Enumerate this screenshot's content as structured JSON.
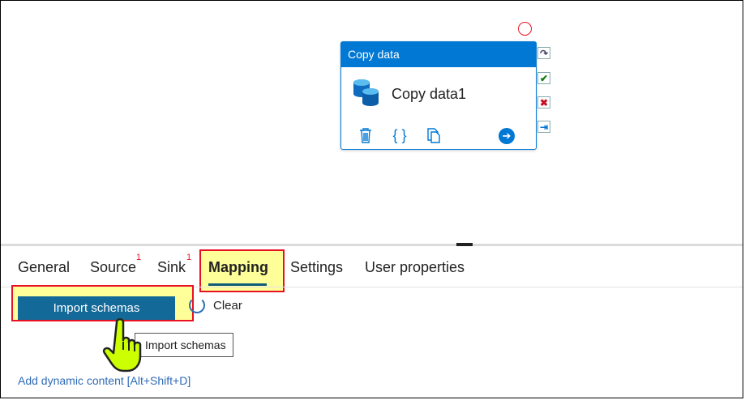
{
  "activity": {
    "header": "Copy data",
    "name": "Copy data1"
  },
  "tabs": [
    {
      "label": "General",
      "badge": ""
    },
    {
      "label": "Source",
      "badge": "1"
    },
    {
      "label": "Sink",
      "badge": "1"
    },
    {
      "label": "Mapping",
      "badge": ""
    },
    {
      "label": "Settings",
      "badge": ""
    },
    {
      "label": "User properties",
      "badge": ""
    }
  ],
  "selected_tab": "Mapping",
  "mapping": {
    "import_label": "Import schemas",
    "clear_label": "Clear",
    "tooltip": "Import schemas",
    "dynamic_link": "Add dynamic content [Alt+Shift+D]"
  },
  "icons": {
    "dataset": "database-icon",
    "delete": "trash-icon",
    "code": "braces-icon",
    "copy": "copy-icon",
    "run": "arrow-right-circle-icon",
    "ports": [
      "redo-icon",
      "check-icon",
      "x-icon",
      "arrow-right-icon"
    ],
    "pointer": "hand-pointer-icon"
  },
  "colors": {
    "accent": "#0078d4",
    "button": "#136a99",
    "highlight": "#ffff99",
    "annotation": "#e81123",
    "success": "#107c10",
    "failure": "#c50f1f"
  }
}
